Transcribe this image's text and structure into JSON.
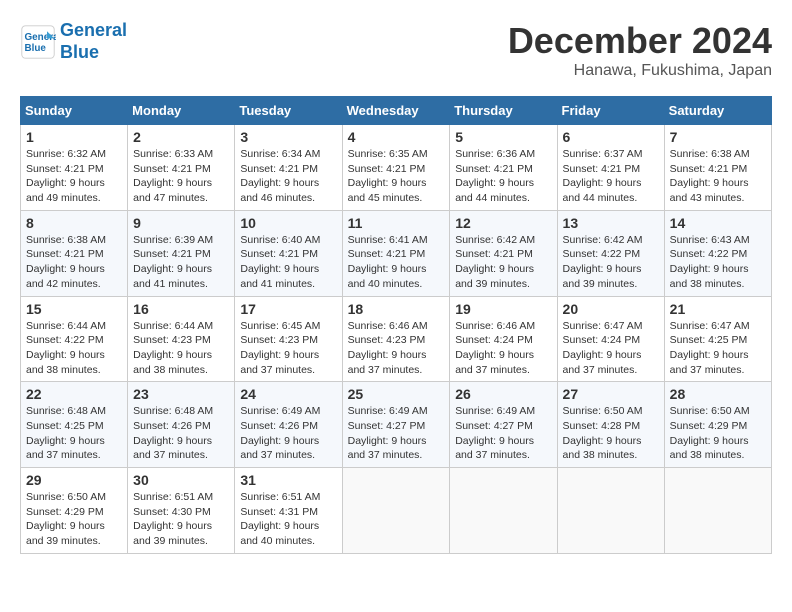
{
  "header": {
    "logo_line1": "General",
    "logo_line2": "Blue",
    "month": "December 2024",
    "location": "Hanawa, Fukushima, Japan"
  },
  "weekdays": [
    "Sunday",
    "Monday",
    "Tuesday",
    "Wednesday",
    "Thursday",
    "Friday",
    "Saturday"
  ],
  "weeks": [
    [
      {
        "day": "1",
        "sunrise": "Sunrise: 6:32 AM",
        "sunset": "Sunset: 4:21 PM",
        "daylight": "Daylight: 9 hours and 49 minutes."
      },
      {
        "day": "2",
        "sunrise": "Sunrise: 6:33 AM",
        "sunset": "Sunset: 4:21 PM",
        "daylight": "Daylight: 9 hours and 47 minutes."
      },
      {
        "day": "3",
        "sunrise": "Sunrise: 6:34 AM",
        "sunset": "Sunset: 4:21 PM",
        "daylight": "Daylight: 9 hours and 46 minutes."
      },
      {
        "day": "4",
        "sunrise": "Sunrise: 6:35 AM",
        "sunset": "Sunset: 4:21 PM",
        "daylight": "Daylight: 9 hours and 45 minutes."
      },
      {
        "day": "5",
        "sunrise": "Sunrise: 6:36 AM",
        "sunset": "Sunset: 4:21 PM",
        "daylight": "Daylight: 9 hours and 44 minutes."
      },
      {
        "day": "6",
        "sunrise": "Sunrise: 6:37 AM",
        "sunset": "Sunset: 4:21 PM",
        "daylight": "Daylight: 9 hours and 44 minutes."
      },
      {
        "day": "7",
        "sunrise": "Sunrise: 6:38 AM",
        "sunset": "Sunset: 4:21 PM",
        "daylight": "Daylight: 9 hours and 43 minutes."
      }
    ],
    [
      {
        "day": "8",
        "sunrise": "Sunrise: 6:38 AM",
        "sunset": "Sunset: 4:21 PM",
        "daylight": "Daylight: 9 hours and 42 minutes."
      },
      {
        "day": "9",
        "sunrise": "Sunrise: 6:39 AM",
        "sunset": "Sunset: 4:21 PM",
        "daylight": "Daylight: 9 hours and 41 minutes."
      },
      {
        "day": "10",
        "sunrise": "Sunrise: 6:40 AM",
        "sunset": "Sunset: 4:21 PM",
        "daylight": "Daylight: 9 hours and 41 minutes."
      },
      {
        "day": "11",
        "sunrise": "Sunrise: 6:41 AM",
        "sunset": "Sunset: 4:21 PM",
        "daylight": "Daylight: 9 hours and 40 minutes."
      },
      {
        "day": "12",
        "sunrise": "Sunrise: 6:42 AM",
        "sunset": "Sunset: 4:21 PM",
        "daylight": "Daylight: 9 hours and 39 minutes."
      },
      {
        "day": "13",
        "sunrise": "Sunrise: 6:42 AM",
        "sunset": "Sunset: 4:22 PM",
        "daylight": "Daylight: 9 hours and 39 minutes."
      },
      {
        "day": "14",
        "sunrise": "Sunrise: 6:43 AM",
        "sunset": "Sunset: 4:22 PM",
        "daylight": "Daylight: 9 hours and 38 minutes."
      }
    ],
    [
      {
        "day": "15",
        "sunrise": "Sunrise: 6:44 AM",
        "sunset": "Sunset: 4:22 PM",
        "daylight": "Daylight: 9 hours and 38 minutes."
      },
      {
        "day": "16",
        "sunrise": "Sunrise: 6:44 AM",
        "sunset": "Sunset: 4:23 PM",
        "daylight": "Daylight: 9 hours and 38 minutes."
      },
      {
        "day": "17",
        "sunrise": "Sunrise: 6:45 AM",
        "sunset": "Sunset: 4:23 PM",
        "daylight": "Daylight: 9 hours and 37 minutes."
      },
      {
        "day": "18",
        "sunrise": "Sunrise: 6:46 AM",
        "sunset": "Sunset: 4:23 PM",
        "daylight": "Daylight: 9 hours and 37 minutes."
      },
      {
        "day": "19",
        "sunrise": "Sunrise: 6:46 AM",
        "sunset": "Sunset: 4:24 PM",
        "daylight": "Daylight: 9 hours and 37 minutes."
      },
      {
        "day": "20",
        "sunrise": "Sunrise: 6:47 AM",
        "sunset": "Sunset: 4:24 PM",
        "daylight": "Daylight: 9 hours and 37 minutes."
      },
      {
        "day": "21",
        "sunrise": "Sunrise: 6:47 AM",
        "sunset": "Sunset: 4:25 PM",
        "daylight": "Daylight: 9 hours and 37 minutes."
      }
    ],
    [
      {
        "day": "22",
        "sunrise": "Sunrise: 6:48 AM",
        "sunset": "Sunset: 4:25 PM",
        "daylight": "Daylight: 9 hours and 37 minutes."
      },
      {
        "day": "23",
        "sunrise": "Sunrise: 6:48 AM",
        "sunset": "Sunset: 4:26 PM",
        "daylight": "Daylight: 9 hours and 37 minutes."
      },
      {
        "day": "24",
        "sunrise": "Sunrise: 6:49 AM",
        "sunset": "Sunset: 4:26 PM",
        "daylight": "Daylight: 9 hours and 37 minutes."
      },
      {
        "day": "25",
        "sunrise": "Sunrise: 6:49 AM",
        "sunset": "Sunset: 4:27 PM",
        "daylight": "Daylight: 9 hours and 37 minutes."
      },
      {
        "day": "26",
        "sunrise": "Sunrise: 6:49 AM",
        "sunset": "Sunset: 4:27 PM",
        "daylight": "Daylight: 9 hours and 37 minutes."
      },
      {
        "day": "27",
        "sunrise": "Sunrise: 6:50 AM",
        "sunset": "Sunset: 4:28 PM",
        "daylight": "Daylight: 9 hours and 38 minutes."
      },
      {
        "day": "28",
        "sunrise": "Sunrise: 6:50 AM",
        "sunset": "Sunset: 4:29 PM",
        "daylight": "Daylight: 9 hours and 38 minutes."
      }
    ],
    [
      {
        "day": "29",
        "sunrise": "Sunrise: 6:50 AM",
        "sunset": "Sunset: 4:29 PM",
        "daylight": "Daylight: 9 hours and 39 minutes."
      },
      {
        "day": "30",
        "sunrise": "Sunrise: 6:51 AM",
        "sunset": "Sunset: 4:30 PM",
        "daylight": "Daylight: 9 hours and 39 minutes."
      },
      {
        "day": "31",
        "sunrise": "Sunrise: 6:51 AM",
        "sunset": "Sunset: 4:31 PM",
        "daylight": "Daylight: 9 hours and 40 minutes."
      },
      null,
      null,
      null,
      null
    ]
  ]
}
